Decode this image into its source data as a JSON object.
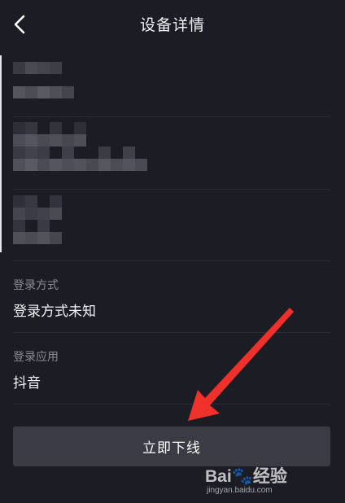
{
  "header": {
    "title": "设备详情",
    "back_icon": "chevron-left-icon"
  },
  "login_method": {
    "label": "登录方式",
    "value": "登录方式未知"
  },
  "login_app": {
    "label": "登录应用",
    "value": "抖音"
  },
  "actions": {
    "offline_label": "立即下线"
  },
  "annotation": {
    "arrow_color": "#f0302a"
  },
  "watermark": {
    "brand": "Bai🐾经验",
    "url": "jingyan.baidu.com"
  },
  "colors": {
    "background": "#1c1c24",
    "button": "#3b3b45",
    "label": "#8b8b95",
    "divider": "#2c2c36"
  }
}
